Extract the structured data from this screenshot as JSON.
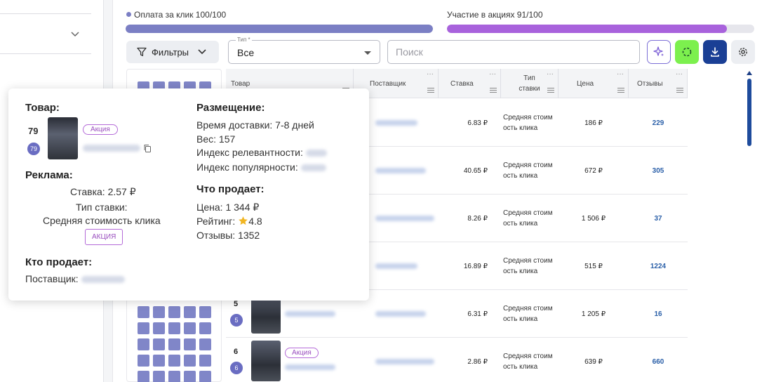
{
  "progress": {
    "cpc": {
      "label": "Оплата за клик 100/100",
      "value": 1.0,
      "color": "#7b7fc4"
    },
    "promos": {
      "label": "Участие в акциях 91/100",
      "value": 0.91,
      "color": "#a862dc"
    }
  },
  "toolbar": {
    "filters_label": "Фильтры",
    "type_legend": "Тип *",
    "type_value": "Все",
    "search_placeholder": "Поиск",
    "ai_icon": "sparkle-icon",
    "refresh_icon": "refresh-icon",
    "download_icon": "download-icon",
    "settings_icon": "gear-icon"
  },
  "table": {
    "headers": {
      "product": "Товар",
      "supplier": "Поставщик",
      "bid": "Ставка",
      "bid_type_line1": "Тип",
      "bid_type_line2": "ставки",
      "price": "Цена",
      "reviews": "Отзывы"
    },
    "rows": [
      {
        "bid": "6.83 ₽",
        "type1": "Средняя стоим",
        "type2": "ость клика",
        "price": "186 ₽",
        "reviews": "229"
      },
      {
        "bid": "40.65 ₽",
        "type1": "Средняя стоим",
        "type2": "ость клика",
        "price": "672 ₽",
        "reviews": "305"
      },
      {
        "bid": "8.26 ₽",
        "type1": "Средняя стоим",
        "type2": "ость клика",
        "price": "1 506 ₽",
        "reviews": "37"
      },
      {
        "bid": "16.89 ₽",
        "type1": "Средняя стоим",
        "type2": "ость клика",
        "price": "515 ₽",
        "reviews": "1224"
      },
      {
        "num": "5",
        "badge": "5",
        "bid": "6.31 ₽",
        "type1": "Средняя стоим",
        "type2": "ость клика",
        "price": "1 205 ₽",
        "reviews": "16"
      },
      {
        "num": "6",
        "badge": "6",
        "promo": "Акция",
        "bid": "2.86 ₽",
        "type1": "Средняя стоим",
        "type2": "ость клика",
        "price": "639 ₽",
        "reviews": "660"
      }
    ]
  },
  "popup": {
    "product_heading": "Товар:",
    "product_num": "79",
    "product_badge": "79",
    "product_promo": "Акция",
    "ads_heading": "Реклама:",
    "bid": "Ставка: 2.57 ₽",
    "bid_type_label": "Тип ставки:",
    "bid_type_value": "Средняя стоимость клика",
    "ads_promo": "АКЦИЯ",
    "seller_heading": "Кто продает:",
    "supplier_label": "Поставщик:",
    "placement_heading": "Размещение:",
    "delivery": "Время доставки: 7-8 дней",
    "weight": "Вес: 157",
    "relevance": "Индекс релевантности:",
    "popularity": "Индекс популярности:",
    "sells_heading": "Что продает:",
    "price": "Цена: 1 344 ₽",
    "rating_label": "Рейтинг:",
    "rating_value": "4.8",
    "reviews": "Отзывы: 1352"
  }
}
